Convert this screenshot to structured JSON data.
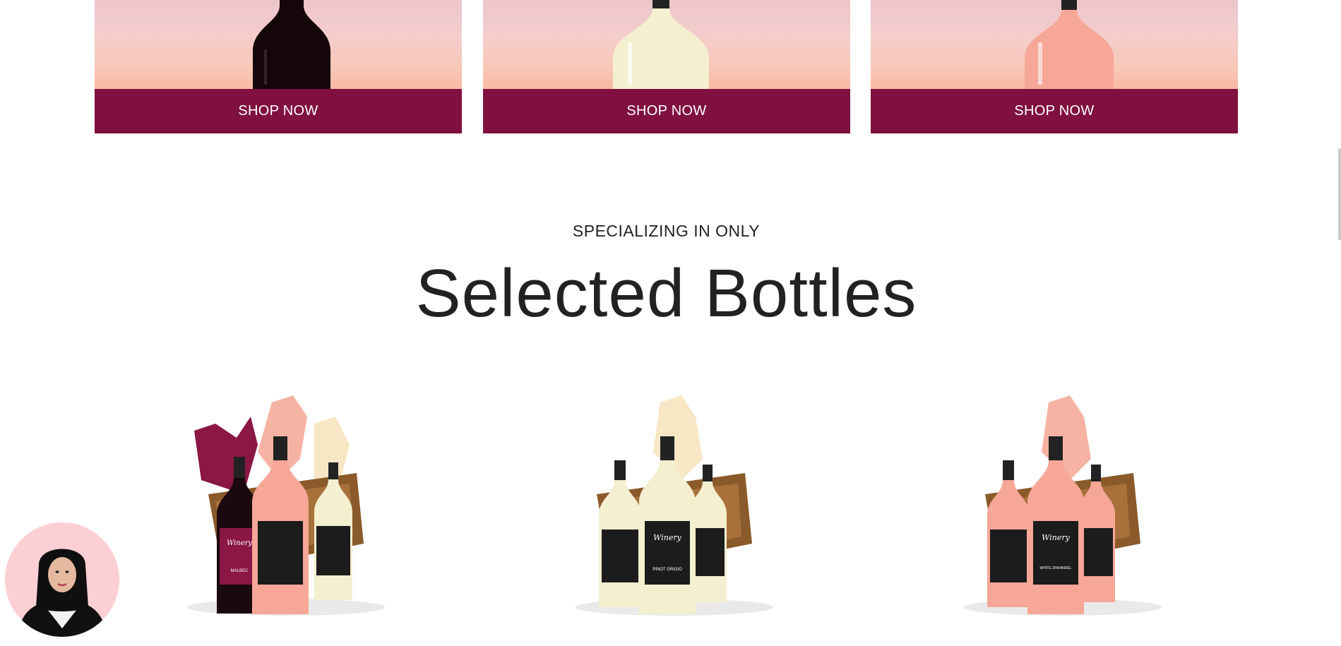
{
  "shop_cards": [
    {
      "button_label": "SHOP NOW",
      "bottle_color": "#1a0a0d"
    },
    {
      "button_label": "SHOP NOW",
      "bottle_color": "#f4efcf"
    },
    {
      "button_label": "SHOP NOW",
      "bottle_color": "#f6a797"
    }
  ],
  "section": {
    "eyebrow": "SPECIALIZING IN ONLY",
    "heading": "Selected Bottles"
  },
  "colors": {
    "accent": "#7f1040",
    "rose": "#f6a797",
    "white_wine": "#f4efcf",
    "red_wine": "#8a1744"
  },
  "bundles": [
    {
      "label_1": "Winery",
      "label_2": "MALBEC"
    },
    {
      "label_1": "Winery",
      "label_2": "PINOT GRIGIO"
    },
    {
      "label_1": "Winery",
      "label_2": "WHITE ZINFANDEL"
    }
  ]
}
